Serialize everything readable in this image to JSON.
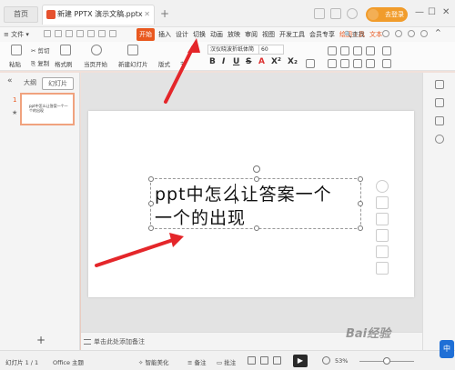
{
  "titlebar": {
    "home_tab": "首页",
    "doc_tab": "新建 PPTX 演示文稿.pptx",
    "login": "去登录"
  },
  "menubar": {
    "file": "文件",
    "tabs": [
      "开始",
      "插入",
      "设计",
      "切换",
      "动画",
      "放映",
      "审阅",
      "视图",
      "开发工具",
      "会员专享",
      "绘图工具",
      "文本"
    ],
    "active_tab": "开始",
    "search": "查找"
  },
  "ribbon": {
    "paste": "粘贴",
    "cut": "剪切",
    "copy": "复制",
    "format_painter": "格式刷",
    "play_from_current": "当页开始",
    "new_slide": "新建幻灯片",
    "layout": "版式",
    "section": "节",
    "font": "汉仪晓波折纸体简",
    "size": "60"
  },
  "leftpanel": {
    "tabs": [
      "大纲",
      "幻灯片"
    ],
    "active_tab": "幻灯片",
    "slide_number": "1",
    "thumb_text": "ppt中怎么让答案一个一个的出现",
    "add": "+"
  },
  "slide": {
    "line1": "ppt中怎么让答案一个",
    "line2": "一个的出现"
  },
  "notes": {
    "placeholder": "单击此处添加备注"
  },
  "statusbar": {
    "slide_count": "幻灯片 1 / 1",
    "theme": "Office 主题",
    "beautify": "智能美化",
    "notes": "备注",
    "comments": "批注",
    "zoom": "53%"
  },
  "watermark": "Bai经验",
  "colors": {
    "accent": "#e9581f",
    "arrow": "#e4262a",
    "login": "#f19c2b"
  }
}
